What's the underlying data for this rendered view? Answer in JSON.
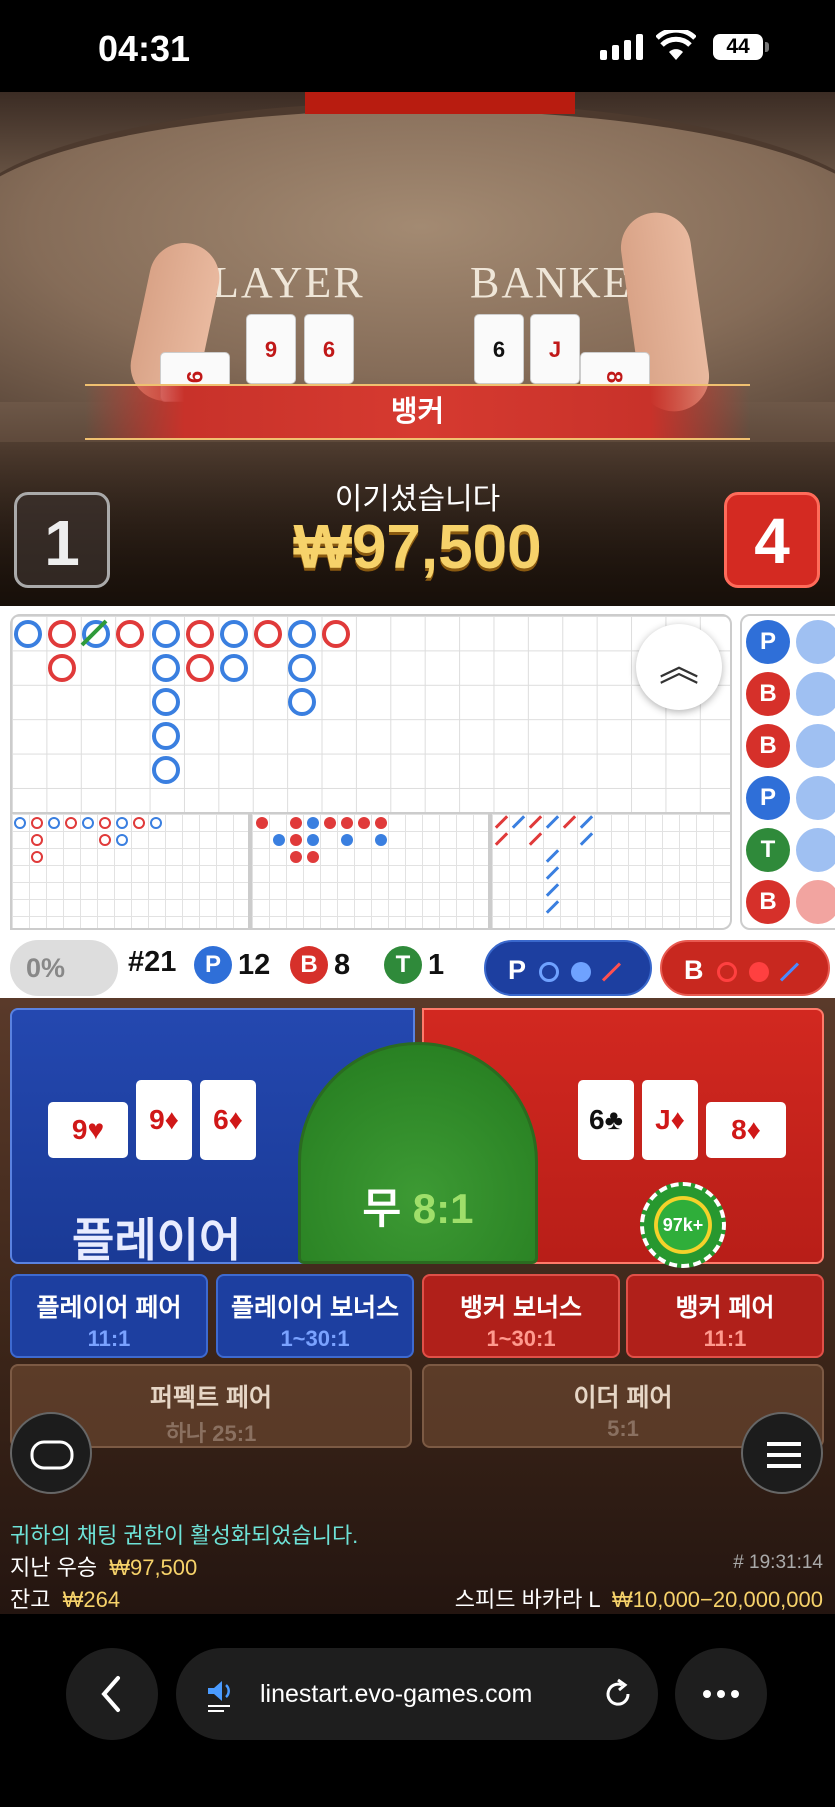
{
  "status_bar": {
    "time": "04:31",
    "battery": "44"
  },
  "video": {
    "table_label_player": "LAYER",
    "table_label_banker": "BANKE",
    "winner_banner": "뱅커",
    "win_message": "이기셨습니다",
    "win_amount": "₩97,500",
    "player_score": "1",
    "banker_score": "4"
  },
  "stats": {
    "percent": "0%",
    "round": "#21",
    "player_label": "P",
    "player_count": "12",
    "banker_label": "B",
    "banker_count": "8",
    "tie_label": "T",
    "tie_count": "1",
    "predict_player": "P",
    "predict_banker": "B"
  },
  "bead_road": [
    "P",
    "B",
    "B",
    "P",
    "T",
    "B"
  ],
  "betting": {
    "player_label": "플레이어",
    "tie_label": "무",
    "tie_odds": "8:1",
    "chip_value": "97k+",
    "player_cards": [
      "9♥",
      "9♦",
      "6♦"
    ],
    "banker_cards": [
      "6♣",
      "J♦",
      "8♦"
    ],
    "side_bets": [
      {
        "name": "플레이어 페어",
        "odds": "11:1"
      },
      {
        "name": "플레이어 보너스",
        "odds": "1~30:1"
      },
      {
        "name": "뱅커 보너스",
        "odds": "1~30:1"
      },
      {
        "name": "뱅커 페어",
        "odds": "11:1"
      },
      {
        "name": "퍼펙트 페어",
        "odds": "하나 25:1"
      },
      {
        "name": "이더 페어",
        "odds": "5:1"
      }
    ]
  },
  "footer": {
    "chat_notice": "귀하의 채팅 권한이 활성화되었습니다.",
    "last_win_label": "지난 우승",
    "last_win_amount": "₩97,500",
    "balance_label": "잔고",
    "balance_amount": "₩264",
    "game_id": "# 19:31:14",
    "table_name": "스피드 바카라 L",
    "limits": "₩10,000−20,000,000"
  },
  "browser": {
    "url": "linestart.evo-games.com"
  },
  "colors": {
    "player_blue": "#1d3fa0",
    "banker_red": "#c8281f",
    "tie_green": "#2f8a28",
    "gold": "#f6d26a"
  }
}
